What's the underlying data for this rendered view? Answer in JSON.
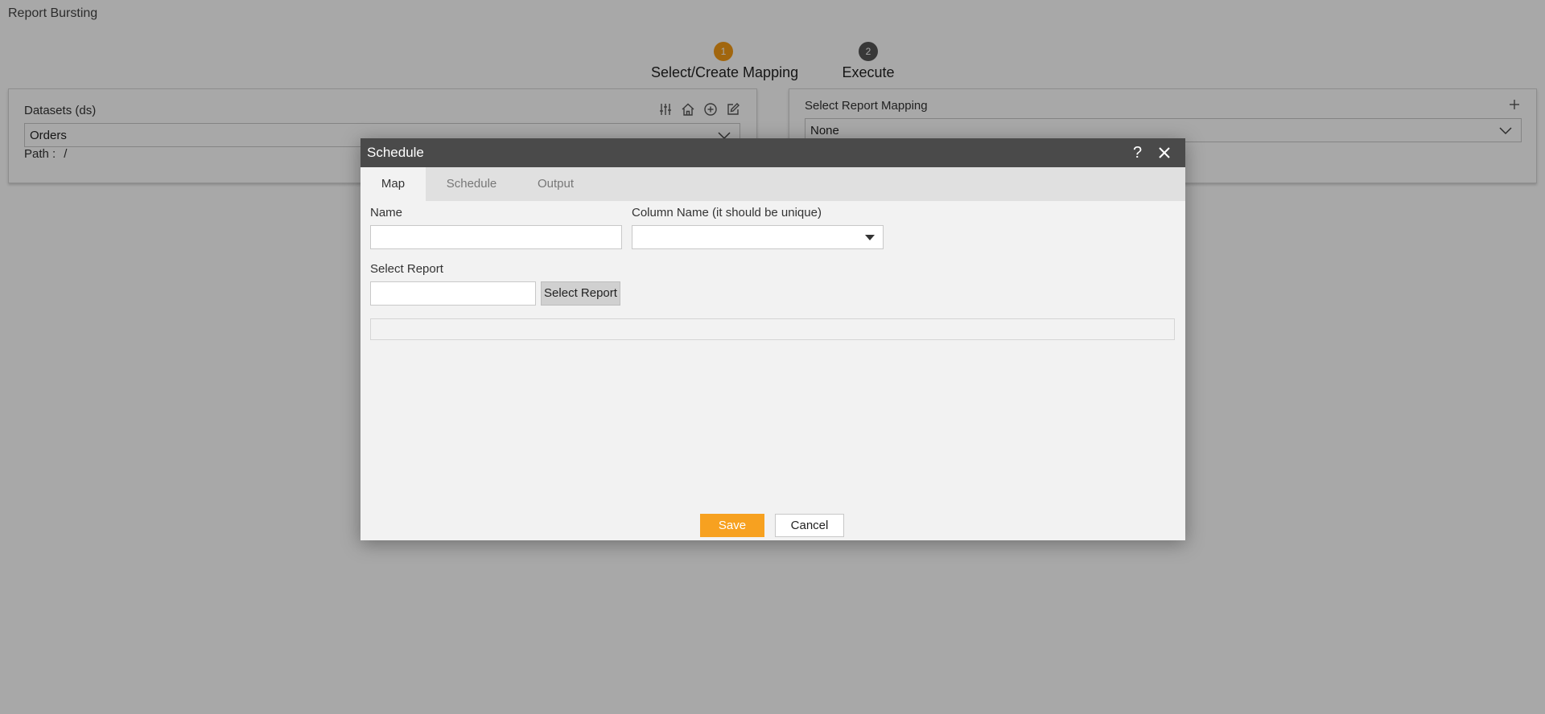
{
  "page": {
    "title": "Report Bursting",
    "steps": [
      {
        "number": "1",
        "label": "Select/Create Mapping",
        "state": "active",
        "color": "#f49b16"
      },
      {
        "number": "2",
        "label": "Execute",
        "state": "inactive",
        "color": "#555555"
      }
    ]
  },
  "left_panel": {
    "label": "Datasets (ds)",
    "selected": "Orders",
    "path_label": "Path :",
    "path_value": "/",
    "icons": [
      "sliders-icon",
      "home-icon",
      "plus-circle-icon",
      "edit-icon"
    ]
  },
  "right_panel": {
    "label": "Select Report Mapping",
    "selected": "None",
    "icons": [
      "plus-icon"
    ]
  },
  "modal": {
    "title": "Schedule",
    "tabs": [
      {
        "label": "Map",
        "active": true
      },
      {
        "label": "Schedule",
        "active": false
      },
      {
        "label": "Output",
        "active": false
      }
    ],
    "name_label": "Name",
    "name_value": "",
    "column_label": "Column Name (it should be unique)",
    "column_value": "",
    "select_report_label": "Select Report",
    "select_report_value": "",
    "select_report_button": "Select Report",
    "save_label": "Save",
    "cancel_label": "Cancel"
  },
  "colors": {
    "accent": "#f7a120",
    "header": "#4a4a4a"
  }
}
